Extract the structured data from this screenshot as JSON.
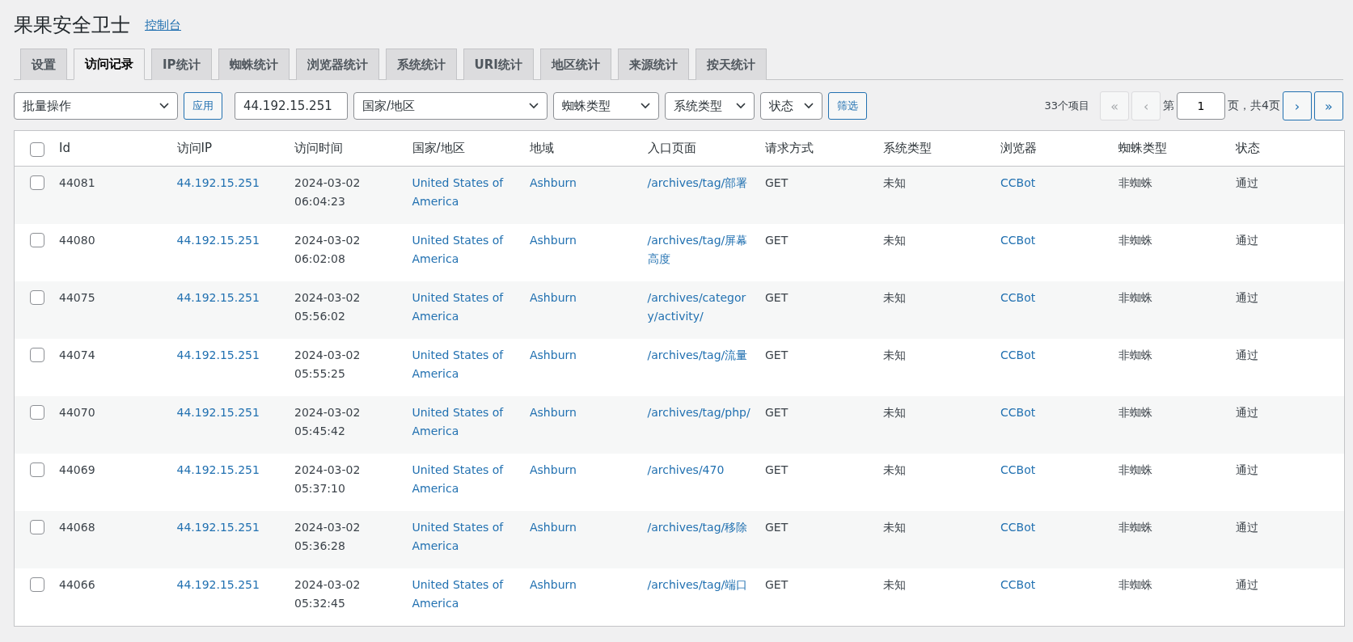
{
  "header": {
    "title": "果果安全卫士",
    "link": "控制台"
  },
  "tabs": [
    {
      "label": "设置",
      "selected": false
    },
    {
      "label": "访问记录",
      "selected": true
    },
    {
      "label": "IP统计",
      "selected": false
    },
    {
      "label": "蜘蛛统计",
      "selected": false
    },
    {
      "label": "浏览器统计",
      "selected": false
    },
    {
      "label": "系统统计",
      "selected": false
    },
    {
      "label": "URI统计",
      "selected": false
    },
    {
      "label": "地区统计",
      "selected": false
    },
    {
      "label": "来源统计",
      "selected": false
    },
    {
      "label": "按天统计",
      "selected": false
    }
  ],
  "filters": {
    "bulk_action": "批量操作",
    "apply": "应用",
    "ip_value": "44.192.15.251",
    "country": "国家/地区",
    "spider_type": "蜘蛛类型",
    "system_type": "系统类型",
    "status": "状态",
    "filter": "筛选"
  },
  "pagination": {
    "count": "33个项目",
    "first": {
      "label": "«",
      "disabled": true
    },
    "prev": {
      "label": "‹",
      "disabled": true
    },
    "page_prefix": "第",
    "page_value": "1",
    "page_suffix": "页，共4页",
    "next": {
      "label": "›",
      "disabled": false
    },
    "last": {
      "label": "»",
      "disabled": false
    }
  },
  "table": {
    "select_all_checked": false,
    "columns": [
      "Id",
      "访问IP",
      "访问时间",
      "国家/地区",
      "地域",
      "入口页面",
      "请求方式",
      "系统类型",
      "浏览器",
      "蜘蛛类型",
      "状态"
    ],
    "rows": [
      {
        "checked": false,
        "cells": [
          "44081",
          "44.192.15.251",
          "2024-03-02 06:04:23",
          "United States of America",
          "Ashburn",
          "/archives/tag/部署",
          "GET",
          "未知",
          "CCBot",
          "非蜘蛛",
          "通过"
        ]
      },
      {
        "checked": false,
        "cells": [
          "44080",
          "44.192.15.251",
          "2024-03-02 06:02:08",
          "United States of America",
          "Ashburn",
          "/archives/tag/屏幕高度",
          "GET",
          "未知",
          "CCBot",
          "非蜘蛛",
          "通过"
        ]
      },
      {
        "checked": false,
        "cells": [
          "44075",
          "44.192.15.251",
          "2024-03-02 05:56:02",
          "United States of America",
          "Ashburn",
          "/archives/category/activity/",
          "GET",
          "未知",
          "CCBot",
          "非蜘蛛",
          "通过"
        ]
      },
      {
        "checked": false,
        "cells": [
          "44074",
          "44.192.15.251",
          "2024-03-02 05:55:25",
          "United States of America",
          "Ashburn",
          "/archives/tag/流量",
          "GET",
          "未知",
          "CCBot",
          "非蜘蛛",
          "通过"
        ]
      },
      {
        "checked": false,
        "cells": [
          "44070",
          "44.192.15.251",
          "2024-03-02 05:45:42",
          "United States of America",
          "Ashburn",
          "/archives/tag/php/",
          "GET",
          "未知",
          "CCBot",
          "非蜘蛛",
          "通过"
        ]
      },
      {
        "checked": false,
        "cells": [
          "44069",
          "44.192.15.251",
          "2024-03-02 05:37:10",
          "United States of America",
          "Ashburn",
          "/archives/470",
          "GET",
          "未知",
          "CCBot",
          "非蜘蛛",
          "通过"
        ]
      },
      {
        "checked": false,
        "cells": [
          "44068",
          "44.192.15.251",
          "2024-03-02 05:36:28",
          "United States of America",
          "Ashburn",
          "/archives/tag/移除",
          "GET",
          "未知",
          "CCBot",
          "非蜘蛛",
          "通过"
        ]
      },
      {
        "checked": false,
        "cells": [
          "44066",
          "44.192.15.251",
          "2024-03-02 05:32:45",
          "United States of America",
          "Ashburn",
          "/archives/tag/端口",
          "GET",
          "未知",
          "CCBot",
          "非蜘蛛",
          "通过"
        ]
      }
    ]
  }
}
